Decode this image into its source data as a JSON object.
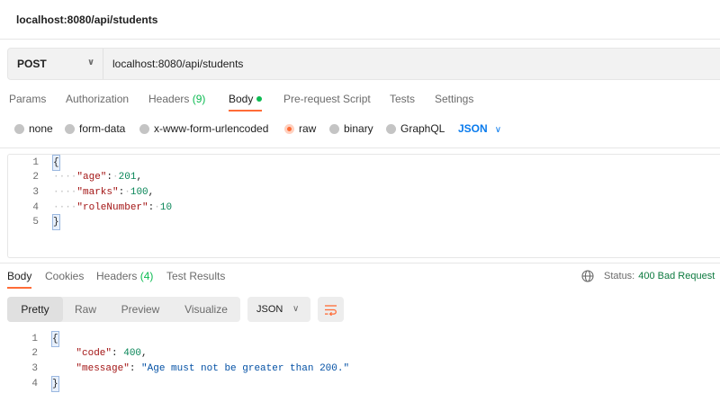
{
  "window": {
    "title": "localhost:8080/api/students"
  },
  "request": {
    "method": "POST",
    "url": "localhost:8080/api/students",
    "tabs": [
      {
        "label": "Params"
      },
      {
        "label": "Authorization"
      },
      {
        "label": "Headers",
        "count": "(9)"
      },
      {
        "label": "Body"
      },
      {
        "label": "Pre-request Script"
      },
      {
        "label": "Tests"
      },
      {
        "label": "Settings"
      }
    ],
    "body_types": [
      "none",
      "form-data",
      "x-www-form-urlencoded",
      "raw",
      "binary",
      "GraphQL"
    ],
    "body_selected": "raw",
    "body_format": "JSON",
    "body_lines": [
      {
        "n": "1",
        "text": "{"
      },
      {
        "n": "2",
        "key": "\"age\"",
        "value": "201",
        "trail": ","
      },
      {
        "n": "3",
        "key": "\"marks\"",
        "value": "100",
        "trail": ","
      },
      {
        "n": "4",
        "key": "\"roleNumber\"",
        "value": "10",
        "trail": ""
      },
      {
        "n": "5",
        "text": "}"
      }
    ]
  },
  "response": {
    "tabs": [
      {
        "label": "Body"
      },
      {
        "label": "Cookies"
      },
      {
        "label": "Headers",
        "count": "(4)"
      },
      {
        "label": "Test Results"
      }
    ],
    "status_label": "Status:",
    "status_value": "400 Bad Request",
    "view_modes": [
      "Pretty",
      "Raw",
      "Preview",
      "Visualize"
    ],
    "format": "JSON",
    "body_lines": [
      {
        "n": "1",
        "text": "{"
      },
      {
        "n": "2",
        "key": "\"code\"",
        "value": "400",
        "trail": ","
      },
      {
        "n": "3",
        "key": "\"message\"",
        "value": "\"Age must not be greater than 200.\"",
        "trail": ""
      },
      {
        "n": "4",
        "text": "}"
      }
    ]
  },
  "colors": {
    "accent": "#ff6c37",
    "count": "#0cbb52",
    "link": "#097bed",
    "status_error": "#0d7a3f"
  }
}
